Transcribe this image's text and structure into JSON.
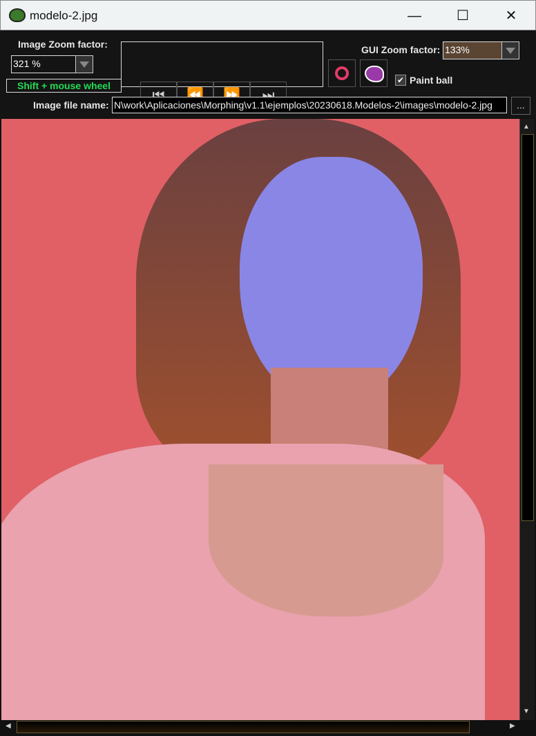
{
  "window": {
    "title": "modelo-2.jpg",
    "minimize": "—",
    "maximize": "☐",
    "close": "✕"
  },
  "toolbar": {
    "image_zoom_label": "Image Zoom factor:",
    "image_zoom_value": "321 %",
    "hint": "Shift + mouse wheel",
    "nav": [
      {
        "icon": "first-icon",
        "glyph": "⏮"
      },
      {
        "icon": "rewind-icon",
        "glyph": "⏪"
      },
      {
        "icon": "forward-icon",
        "glyph": "⏩"
      },
      {
        "icon": "last-icon",
        "glyph": "⏭"
      }
    ],
    "gui_zoom_label": "GUI Zoom factor:",
    "gui_zoom_value": "133%",
    "paint_ball_label": "Paint ball",
    "paint_ball_checked": true,
    "file_label": "Image file name:",
    "file_value": "N\\work\\Aplicaciones\\Morphing\\v1.1\\ejemplos\\20230618.Modelos-2\\images\\modelo-2.jpg",
    "browse": "..."
  },
  "colors": {
    "hint": "#22dd55",
    "background": "#e06066",
    "gui_zoom_bg": "#5a4432"
  }
}
